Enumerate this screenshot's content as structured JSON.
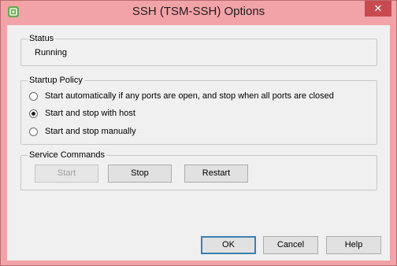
{
  "window": {
    "title": "SSH (TSM-SSH) Options",
    "close_glyph": "✕",
    "icon": "vsphere-app-icon"
  },
  "status": {
    "label": "Status",
    "value": "Running"
  },
  "startup_policy": {
    "label": "Startup Policy",
    "options": [
      {
        "label": "Start automatically if any ports are open, and stop when all ports are closed",
        "selected": false
      },
      {
        "label": "Start and stop with host",
        "selected": true
      },
      {
        "label": "Start and stop manually",
        "selected": false
      }
    ]
  },
  "service_commands": {
    "label": "Service Commands",
    "start_label": "Start",
    "stop_label": "Stop",
    "restart_label": "Restart",
    "start_enabled": false
  },
  "footer": {
    "ok_label": "OK",
    "cancel_label": "Cancel",
    "help_label": "Help"
  },
  "colors": {
    "frame": "#f2a3a8",
    "client": "#f0f0f0",
    "close": "#c74a4f"
  }
}
